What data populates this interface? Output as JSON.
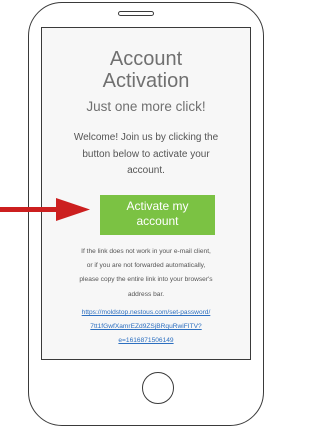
{
  "email": {
    "title_line1": "Account",
    "title_line2": "Activation",
    "subtitle": "Just one more click!",
    "welcome_line1": "Welcome! Join us by clicking the",
    "welcome_line2": "button below to activate your",
    "welcome_line3": "account.",
    "button_line1": "Activate my",
    "button_line2": "account",
    "fallback_line1": "If the link does not work in your e-mail client,",
    "fallback_line2": "or if you are not forwarded automatically,",
    "fallback_line3": "please copy the entire link into your browser's",
    "fallback_line4": "address bar.",
    "link_line1": "https://moldstop.nestous.com/set-password/",
    "link_line2": "7tt1fGwfXamrEZd9ZSjBRquRwiFITV?",
    "link_line3": "e=1616871506149"
  },
  "colors": {
    "button": "#7bc243",
    "link": "#2c6fc0",
    "arrow": "#cc1f1f"
  },
  "icons": {
    "pointer": "red-arrow-icon"
  }
}
